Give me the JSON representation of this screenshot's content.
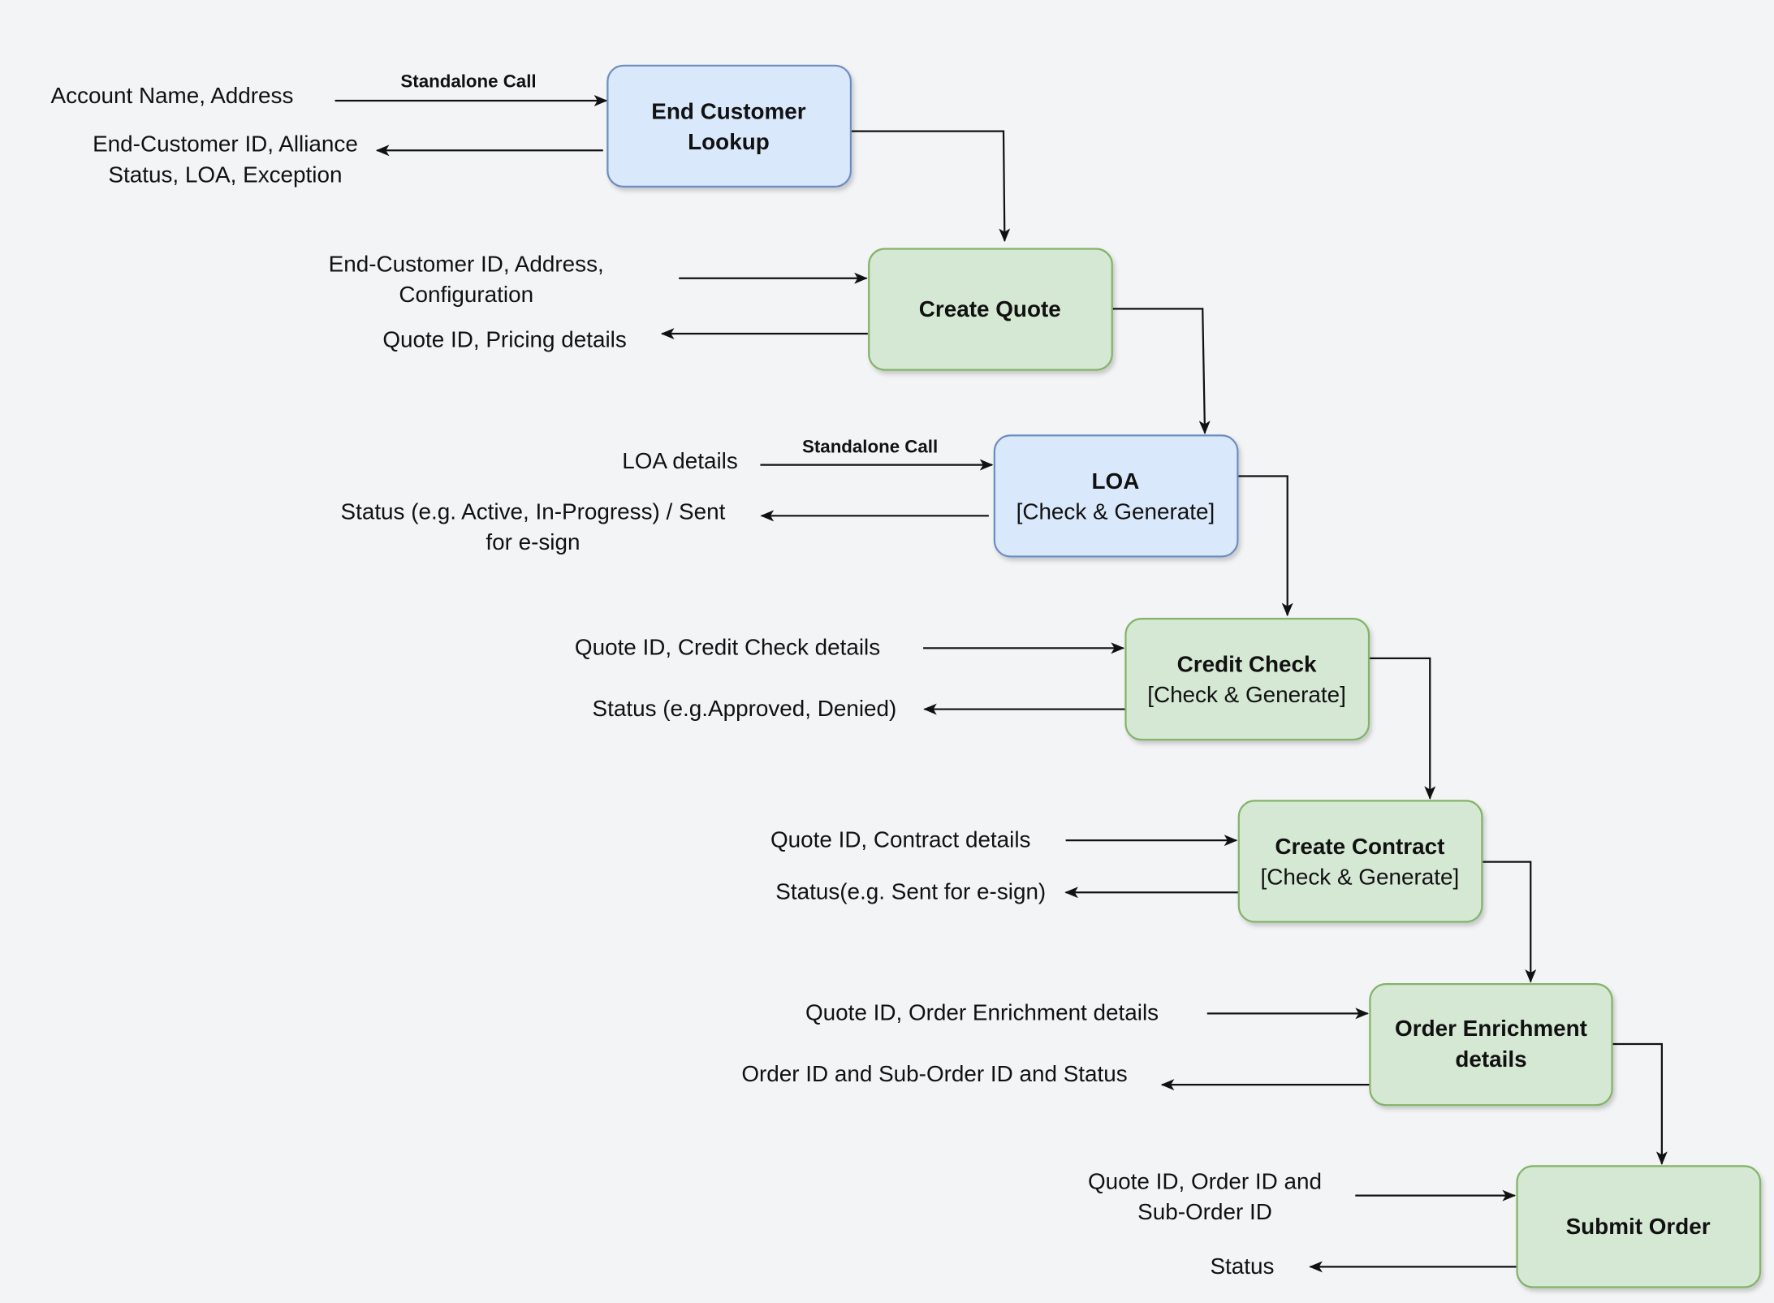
{
  "colors": {
    "background": "#f3f4f6",
    "blue_fill": "#dae8fc",
    "blue_stroke": "#6c8ebf",
    "green_fill": "#d5e8d4",
    "green_stroke": "#82b366"
  },
  "steps": [
    {
      "title": [
        "End Customer",
        "Lookup"
      ],
      "color": "blue",
      "call_label": "Standalone Call",
      "input": [
        "Account Name, Address"
      ],
      "output": [
        "End-Customer ID, Alliance",
        "Status, LOA, Exception"
      ]
    },
    {
      "title": [
        "Create Quote"
      ],
      "color": "green",
      "input": [
        "End-Customer ID, Address,",
        "Configuration"
      ],
      "output": [
        "Quote ID, Pricing details"
      ]
    },
    {
      "title": [
        "LOA"
      ],
      "subtitle": "[Check & Generate]",
      "color": "blue",
      "call_label": "Standalone Call",
      "input": [
        "LOA details"
      ],
      "output": [
        "Status (e.g. Active, In-Progress) / Sent",
        "for e-sign"
      ]
    },
    {
      "title": [
        "Credit Check"
      ],
      "subtitle": "[Check & Generate]",
      "color": "green",
      "input": [
        "Quote ID, Credit Check details"
      ],
      "output": [
        "Status (e.g.Approved, Denied)"
      ]
    },
    {
      "title": [
        "Create Contract"
      ],
      "subtitle": "[Check & Generate]",
      "color": "green",
      "input": [
        "Quote ID, Contract details"
      ],
      "output": [
        "Status(e.g. Sent for e-sign)"
      ]
    },
    {
      "title": [
        "Order Enrichment",
        "details"
      ],
      "color": "green",
      "input": [
        "Quote ID, Order Enrichment details"
      ],
      "output": [
        "Order ID and Sub-Order ID and Status"
      ]
    },
    {
      "title": [
        "Submit Order"
      ],
      "color": "green",
      "input": [
        "Quote ID, Order ID and",
        "Sub-Order ID"
      ],
      "output": [
        "Status"
      ]
    }
  ]
}
